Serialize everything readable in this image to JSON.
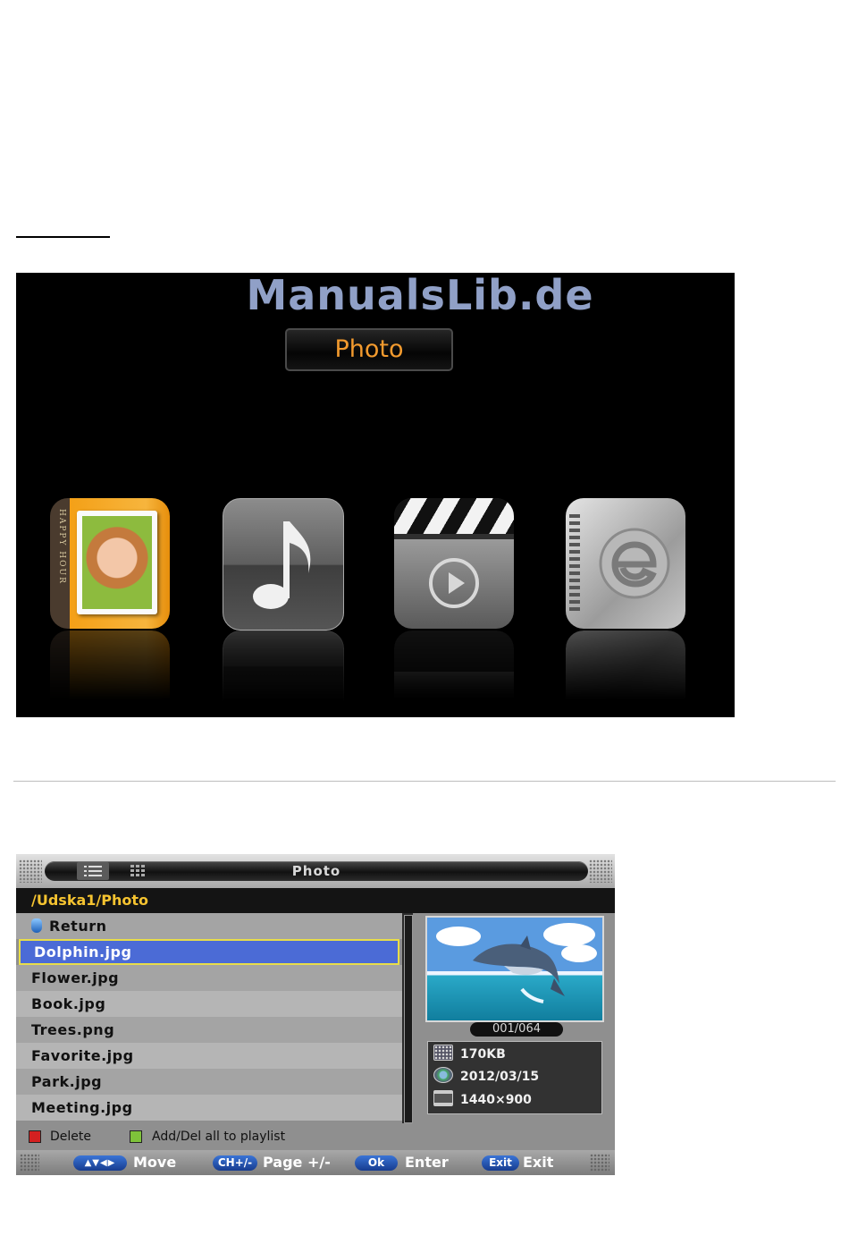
{
  "media_menu": {
    "title": "Photo",
    "icons": [
      {
        "id": "photo",
        "icon": "photo-album-icon",
        "spine_text": "HAPPY HOUR"
      },
      {
        "id": "music",
        "icon": "music-note-icon"
      },
      {
        "id": "movie",
        "icon": "clapperboard-icon"
      },
      {
        "id": "ebook",
        "icon": "ebook-icon"
      }
    ]
  },
  "watermark": "ManualsLib.de",
  "browser": {
    "title": "Photo",
    "path": "/Udska1/Photo",
    "files": [
      {
        "label": "Return",
        "icon": "return-icon"
      },
      {
        "label": "Dolphin.jpg",
        "selected": true
      },
      {
        "label": "Flower.jpg"
      },
      {
        "label": "Book.jpg"
      },
      {
        "label": "Trees.png"
      },
      {
        "label": "Favorite.jpg"
      },
      {
        "label": "Park.jpg"
      },
      {
        "label": "Meeting.jpg"
      }
    ],
    "counter": "001/064",
    "info": {
      "size": "170KB",
      "date": "2012/03/15",
      "resolution": "1440×900"
    },
    "legend": {
      "delete_label": "Delete",
      "add_label": "Add/Del all to playlist",
      "red": "#d42020",
      "green": "#7ec23a"
    },
    "footer": [
      {
        "key": "▲▼◀▶",
        "label": "Move"
      },
      {
        "key": "CH+/-",
        "label": "Page +/-"
      },
      {
        "key": "Ok",
        "label": "Enter"
      },
      {
        "key": "Exit",
        "label": "Exit"
      }
    ],
    "colors": {
      "path_text": "#f5c330",
      "selection": "#4b6bd6",
      "selection_border": "#e8dd4a"
    }
  }
}
